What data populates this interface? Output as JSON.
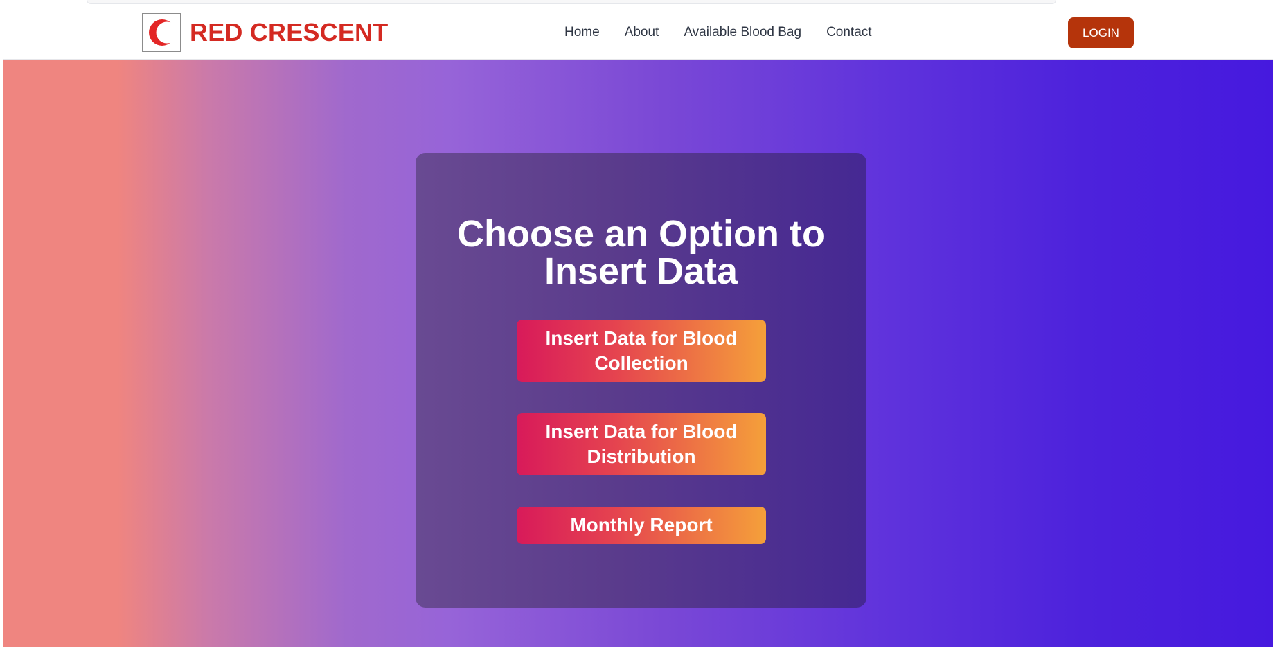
{
  "brand": {
    "name": "RED CRESCENT",
    "logo_icon": "crescent-icon",
    "color": "#d42a22"
  },
  "nav": {
    "links": [
      "Home",
      "About",
      "Available Blood Bag",
      "Contact"
    ],
    "login_label": "LOGIN"
  },
  "main": {
    "title": "Choose an Option to Insert Data",
    "buttons": [
      "Insert Data for Blood Collection",
      "Insert Data for Blood Distribution",
      "Monthly Report"
    ]
  },
  "colors": {
    "login_button": "#b5340b",
    "button_gradient_start": "#d81a5a",
    "button_gradient_end": "#f5a03a",
    "hero_gradient_start": "#ef8580",
    "hero_gradient_end": "#4619de",
    "card": "#5a3b8c"
  }
}
